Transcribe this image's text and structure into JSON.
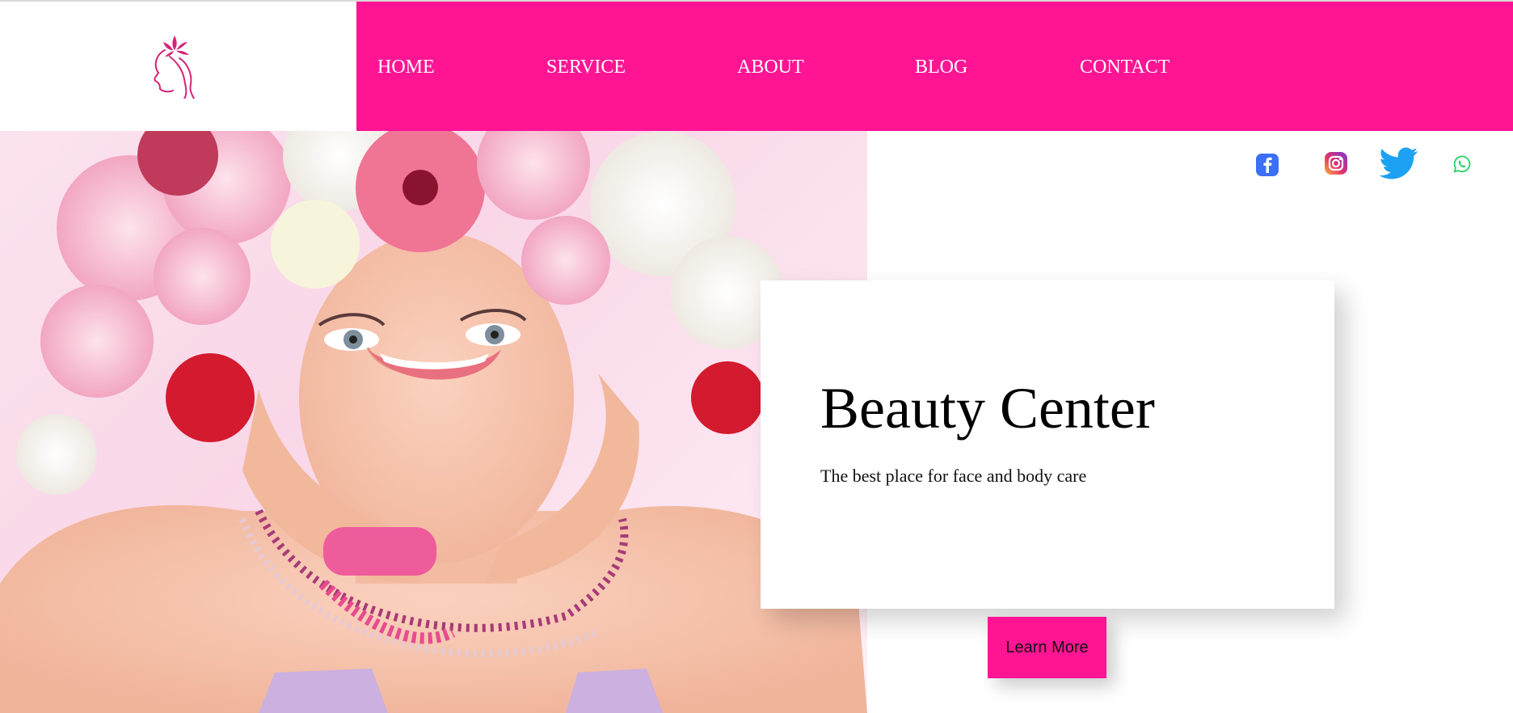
{
  "brand": {
    "logo_icon": "woman-face-flower-logo-icon",
    "logo_color": "#d6237a"
  },
  "nav": {
    "background": "#ff1493",
    "items": [
      {
        "label": "HOME"
      },
      {
        "label": "SERVICE"
      },
      {
        "label": "ABOUT"
      },
      {
        "label": "BLOG"
      },
      {
        "label": "CONTACT"
      }
    ]
  },
  "hero": {
    "image_icon": "woman-with-flower-crown-photo",
    "title": "Beauty Center",
    "subtitle": "The best place for face and body care",
    "cta_label": "Learn More",
    "cta_color": "#ff1493"
  },
  "socials": [
    {
      "icon": "facebook-icon",
      "color": "#3b6ff5"
    },
    {
      "icon": "instagram-icon",
      "color": "#c13584"
    },
    {
      "icon": "twitter-icon",
      "color": "#1da1f2"
    },
    {
      "icon": "whatsapp-icon",
      "color": "#25d366"
    }
  ]
}
